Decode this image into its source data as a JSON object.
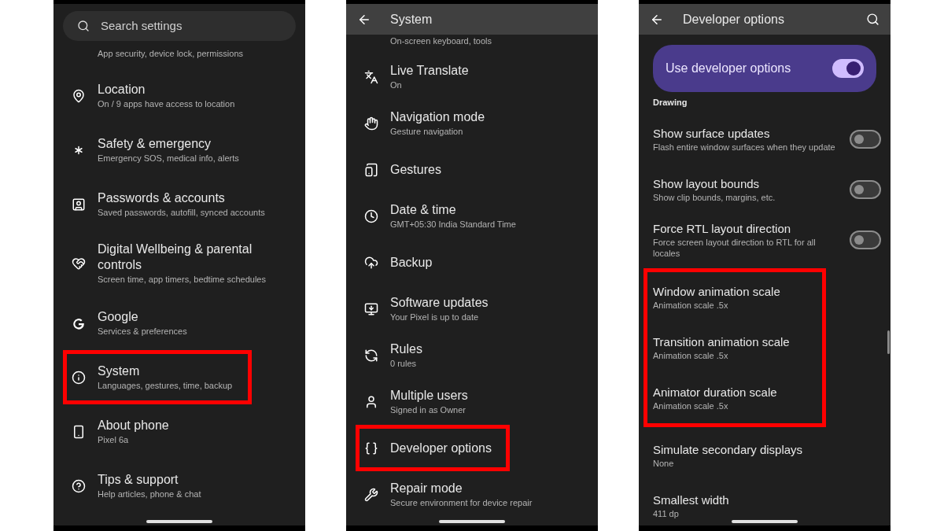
{
  "panels": [
    {
      "kind": "home",
      "search": {
        "placeholder": "Search settings"
      },
      "partial_text": "App security, device lock, permissions",
      "items": [
        {
          "title": "Location",
          "subtitle": "On / 9 apps have access to location",
          "highlighted": false
        },
        {
          "title": "Safety & emergency",
          "subtitle": "Emergency SOS, medical info, alerts",
          "highlighted": false
        },
        {
          "title": "Passwords & accounts",
          "subtitle": "Saved passwords, autofill, synced accounts",
          "highlighted": false
        },
        {
          "title": "Digital Wellbeing & parental controls",
          "subtitle": "Screen time, app timers, bedtime schedules",
          "highlighted": false
        },
        {
          "title": "Google",
          "subtitle": "Services & preferences",
          "highlighted": false
        },
        {
          "title": "System",
          "subtitle": "Languages, gestures, time, backup",
          "highlighted": true
        },
        {
          "title": "About phone",
          "subtitle": "Pixel 6a",
          "highlighted": false
        },
        {
          "title": "Tips & support",
          "subtitle": "Help articles, phone & chat",
          "highlighted": false
        }
      ]
    },
    {
      "kind": "list",
      "header": {
        "title": "System"
      },
      "partial_text": "On-screen keyboard, tools",
      "items": [
        {
          "title": "Live Translate",
          "subtitle": "On",
          "highlighted": false
        },
        {
          "title": "Navigation mode",
          "subtitle": "Gesture navigation",
          "highlighted": false
        },
        {
          "title": "Gestures",
          "highlighted": false
        },
        {
          "title": "Date & time",
          "subtitle": "GMT+05:30 India Standard Time",
          "highlighted": false
        },
        {
          "title": "Backup",
          "highlighted": false
        },
        {
          "title": "Software updates",
          "subtitle": "Your Pixel is up to date",
          "highlighted": false
        },
        {
          "title": "Rules",
          "subtitle": "0 rules",
          "highlighted": false
        },
        {
          "title": "Multiple users",
          "subtitle": "Signed in as Owner",
          "highlighted": false
        },
        {
          "title": "Developer options",
          "highlighted": true
        },
        {
          "title": "Repair mode",
          "subtitle": "Secure environment for device repair",
          "highlighted": false
        }
      ]
    },
    {
      "kind": "developer",
      "header": {
        "title": "Developer options"
      },
      "master_switch": {
        "label": "Use developer options",
        "on": true
      },
      "section": "Drawing",
      "items": [
        {
          "kind": "toggle",
          "title": "Show surface updates",
          "subtitle": "Flash entire window surfaces when they update",
          "on": false,
          "highlighted": false
        },
        {
          "kind": "toggle",
          "title": "Show layout bounds",
          "subtitle": "Show clip bounds, margins, etc.",
          "on": false,
          "highlighted": false
        },
        {
          "kind": "toggle",
          "title": "Force RTL layout direction",
          "subtitle": "Force screen layout direction to RTL for all locales",
          "on": false,
          "highlighted": false
        },
        {
          "kind": "value",
          "title": "Window animation scale",
          "subtitle": "Animation scale .5x",
          "highlighted": true
        },
        {
          "kind": "value",
          "title": "Transition animation scale",
          "subtitle": "Animation scale .5x",
          "highlighted": true
        },
        {
          "kind": "value",
          "title": "Animator duration scale",
          "subtitle": "Animation scale .5x",
          "highlighted": true
        },
        {
          "kind": "value",
          "title": "Simulate secondary displays",
          "subtitle": "None",
          "highlighted": false
        },
        {
          "kind": "value",
          "title": "Smallest width",
          "subtitle": "411 dp",
          "highlighted": false
        }
      ]
    }
  ]
}
